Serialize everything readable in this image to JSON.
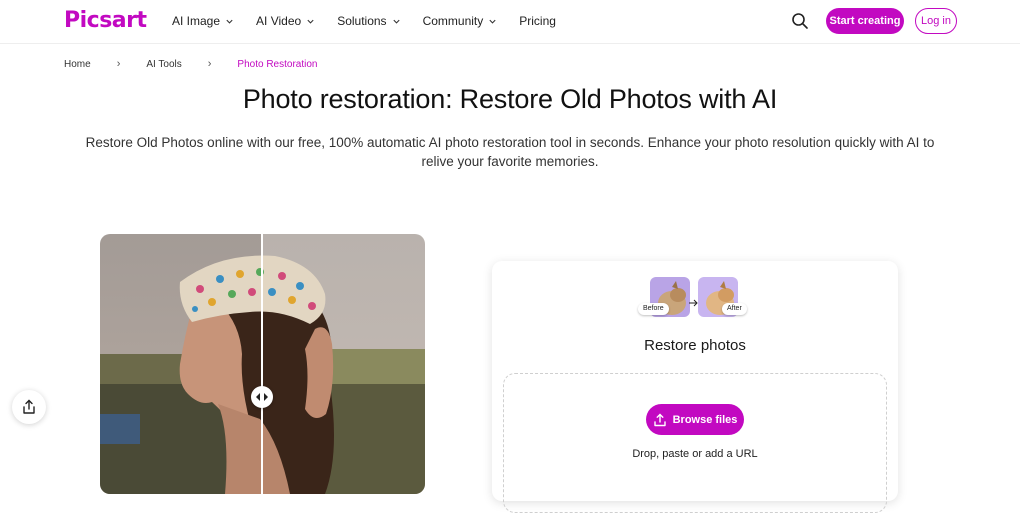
{
  "colors": {
    "brand": "#c209c1",
    "text": "#1f1f1f"
  },
  "header": {
    "logo": "Picsart",
    "nav": [
      {
        "label": "AI Image",
        "has_dropdown": true
      },
      {
        "label": "AI Video",
        "has_dropdown": true
      },
      {
        "label": "Solutions",
        "has_dropdown": true
      },
      {
        "label": "Community",
        "has_dropdown": true
      },
      {
        "label": "Pricing",
        "has_dropdown": false
      }
    ],
    "search_icon": "search-icon",
    "start_creating": "Start creating",
    "login": "Log in"
  },
  "breadcrumb": {
    "items": [
      "Home",
      "AI Tools",
      "Photo Restoration"
    ]
  },
  "main": {
    "title": "Photo restoration: Restore Old Photos with AI",
    "subtitle": "Restore Old Photos online with our free, 100% automatic AI photo restoration tool in seconds. Enhance your photo resolution quickly with AI to relive your favorite memories."
  },
  "upload_card": {
    "before_label": "Before",
    "after_label": "After",
    "title": "Restore photos",
    "browse_label": "Browse files",
    "hint": "Drop, paste or add a URL"
  },
  "share_icon": "share-icon"
}
